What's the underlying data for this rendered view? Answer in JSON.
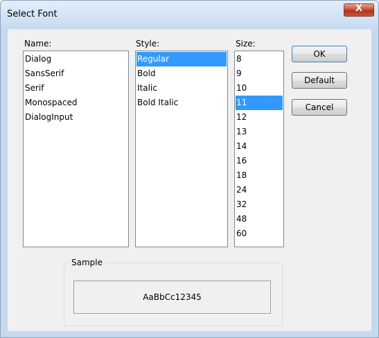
{
  "window": {
    "title": "Select Font",
    "close_glyph": "X"
  },
  "name_list": {
    "label": "Name:",
    "items": [
      "Dialog",
      "SansSerif",
      "Serif",
      "Monospaced",
      "DialogInput"
    ],
    "selected": null
  },
  "style_list": {
    "label": "Style:",
    "items": [
      "Regular",
      "Bold",
      "Italic",
      "Bold Italic"
    ],
    "selected": "Regular"
  },
  "size_list": {
    "label": "Size:",
    "items": [
      "8",
      "9",
      "10",
      "11",
      "12",
      "13",
      "14",
      "16",
      "18",
      "24",
      "32",
      "48",
      "60"
    ],
    "selected": "11"
  },
  "buttons": {
    "ok": "OK",
    "default": "Default",
    "cancel": "Cancel"
  },
  "sample": {
    "label": "Sample",
    "text": "AaBbCc12345"
  },
  "colors": {
    "selection": "#3399ff",
    "dialog_bg": "#f0f0f0",
    "frame": "#c5d9ee"
  }
}
